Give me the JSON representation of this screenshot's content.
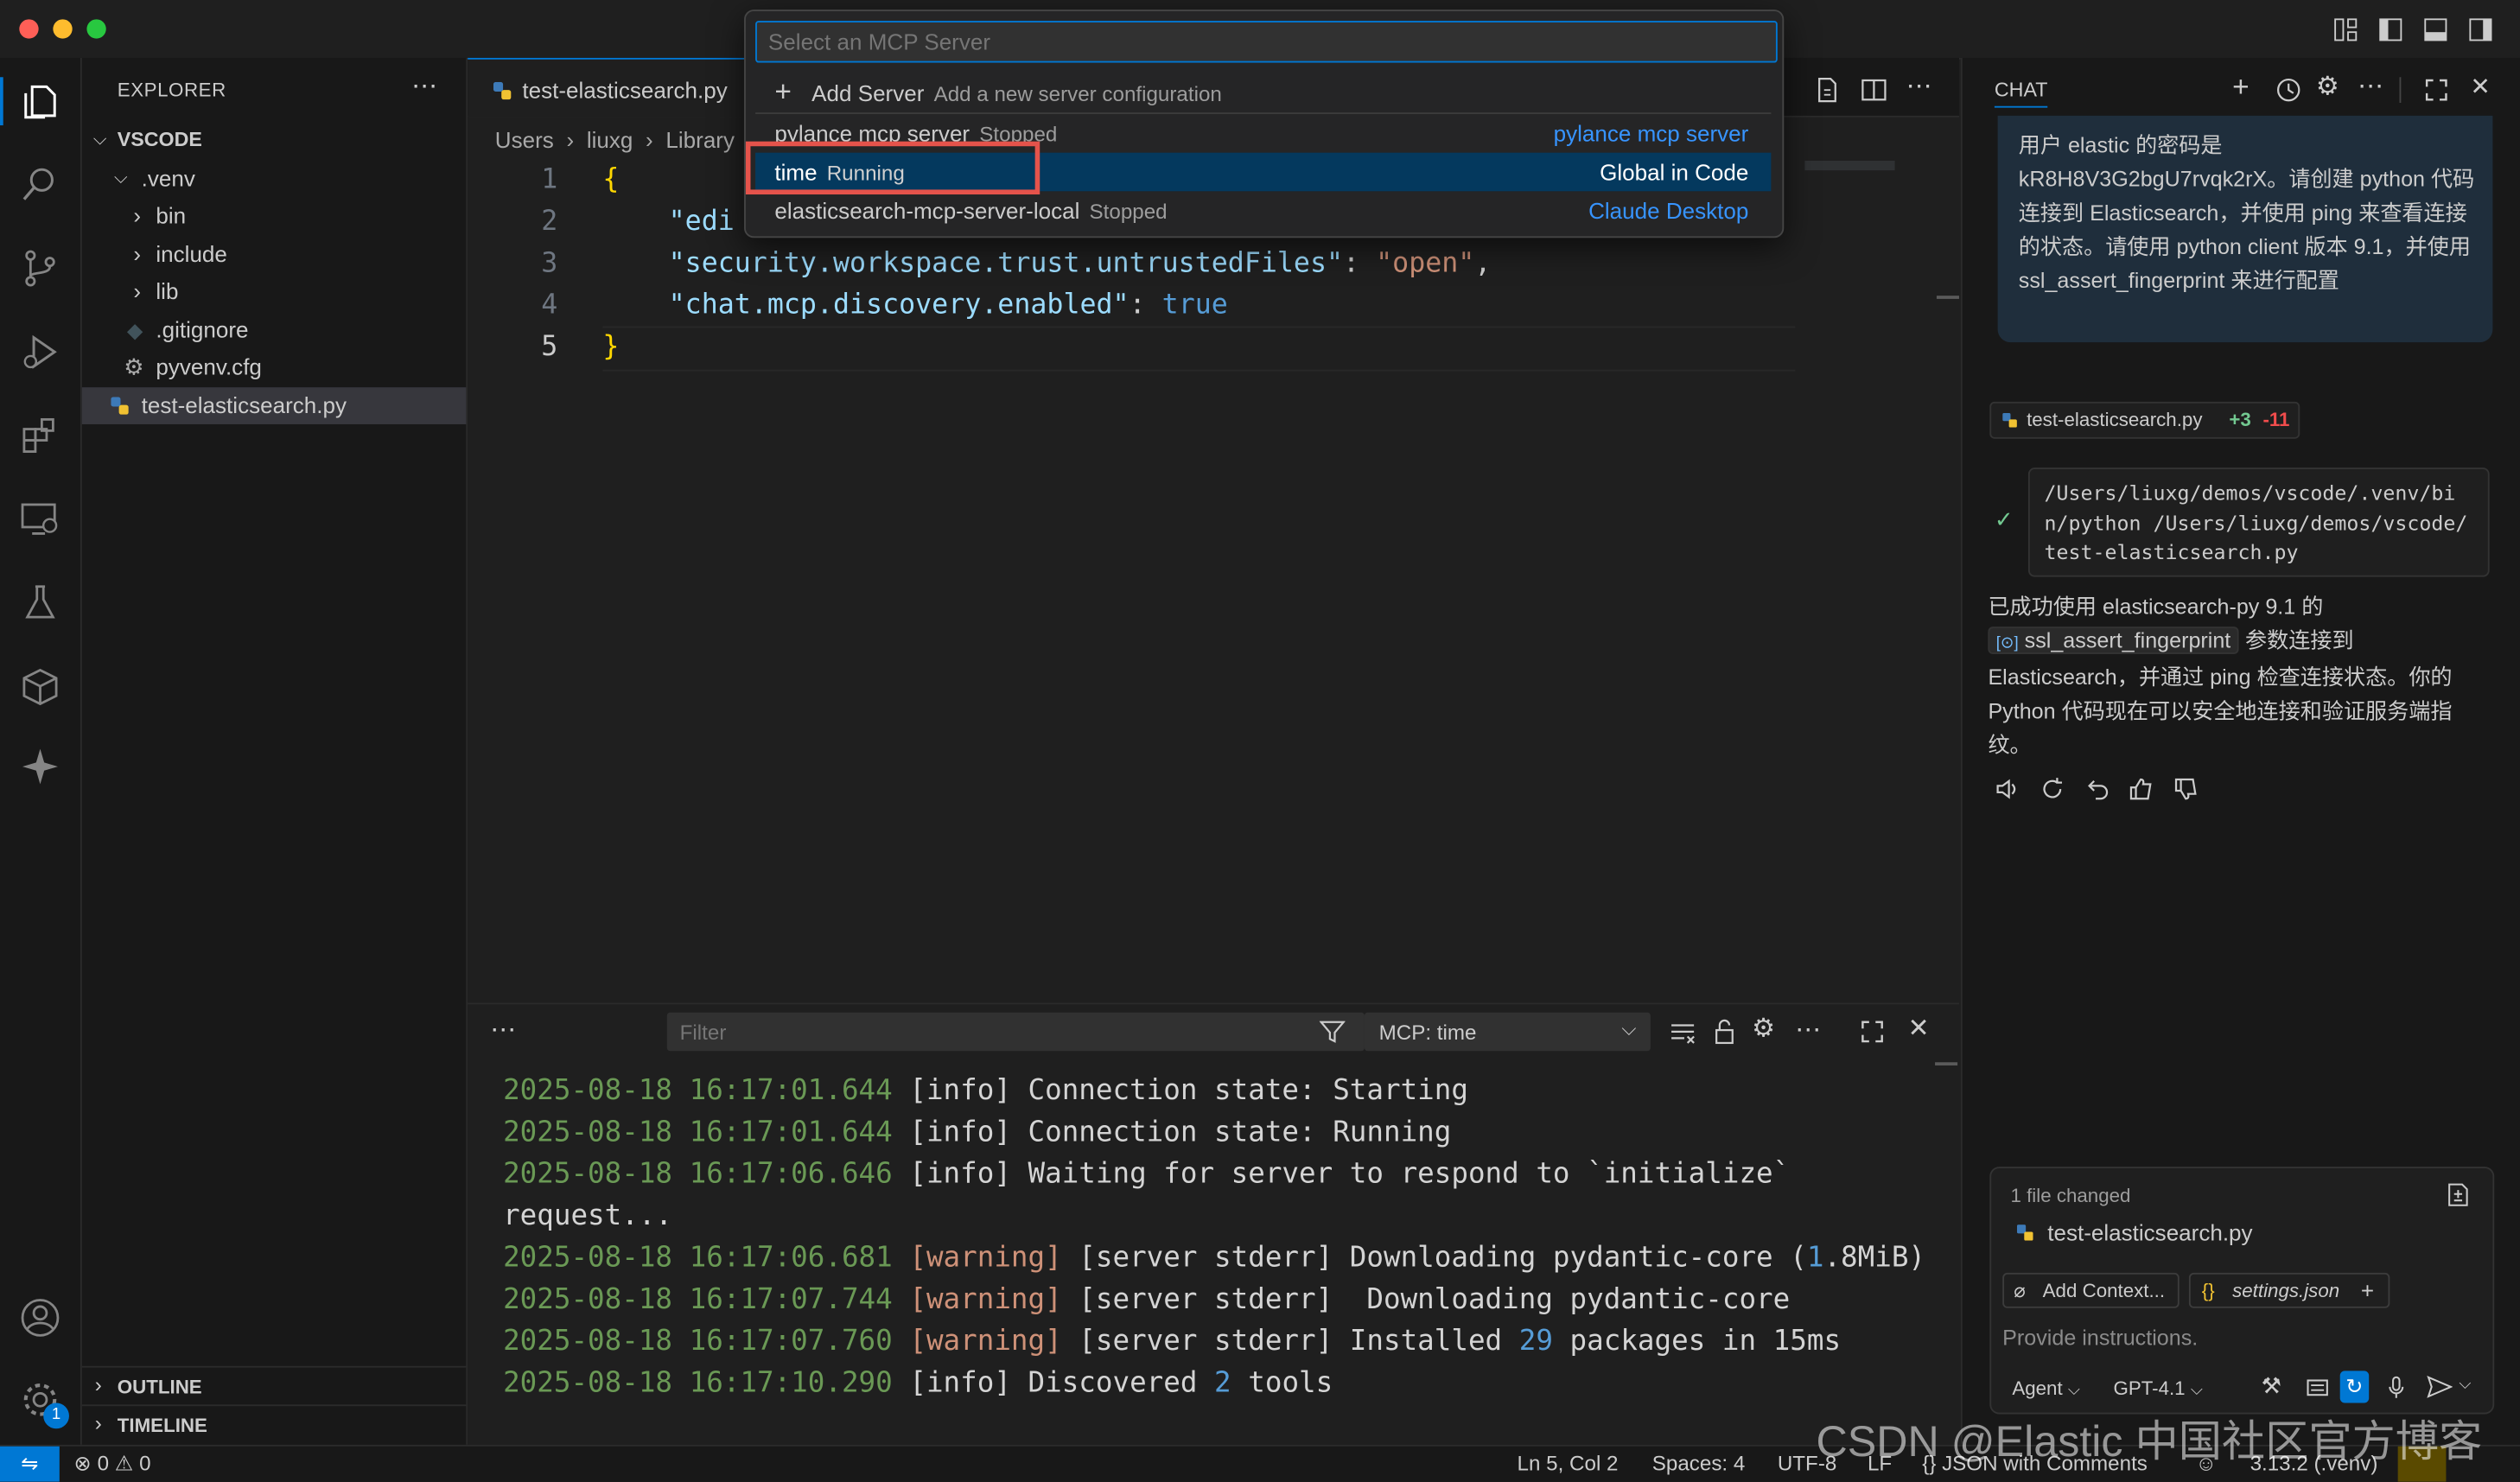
{
  "quick_pick": {
    "placeholder": "Select an MCP Server",
    "add_server": {
      "label": "Add Server",
      "desc": "Add a new server configuration"
    },
    "servers": [
      {
        "name": "pylance mcp server",
        "status": "Stopped",
        "source": "pylance mcp server"
      },
      {
        "name": "time",
        "status": "Running",
        "source": "Global in Code"
      },
      {
        "name": "elasticsearch-mcp-server-local",
        "status": "Stopped",
        "source": "Claude Desktop"
      }
    ]
  },
  "sidebar": {
    "title": "EXPLORER",
    "folder": "VSCODE",
    "items": [
      {
        "label": ".venv"
      },
      {
        "label": "bin"
      },
      {
        "label": "include"
      },
      {
        "label": "lib"
      },
      {
        "label": ".gitignore"
      },
      {
        "label": "pyvenv.cfg"
      },
      {
        "label": "test-elasticsearch.py"
      }
    ],
    "outline": "OUTLINE",
    "timeline": "TIMELINE"
  },
  "editor": {
    "tab": "test-elasticsearch.py",
    "breadcrumb": [
      "Users",
      "liuxg",
      "Library"
    ],
    "line_numbers": [
      "1",
      "2",
      "3",
      "4",
      "5"
    ],
    "lines": {
      "l1": "{",
      "l2_key": "\"edi",
      "l3_key": "\"security.workspace.trust.untrustedFiles\"",
      "l3_val": "\"open\"",
      "l4_key": "\"chat.mcp.discovery.enabled\"",
      "l4_val": "true",
      "l5": "}"
    }
  },
  "panel": {
    "filter_placeholder": "Filter",
    "channel": "MCP: time",
    "logs": [
      {
        "ts": "2025-08-18 16:17:01.644",
        "level": "[info]",
        "pre": " Connection state: Starting",
        "num": "",
        "post": ""
      },
      {
        "ts": "2025-08-18 16:17:01.644",
        "level": "[info]",
        "pre": " Connection state: Running",
        "num": "",
        "post": ""
      },
      {
        "ts": "2025-08-18 16:17:06.646",
        "level": "[info]",
        "pre": " Waiting for server to respond to `initialize`",
        "num": "",
        "post": ""
      },
      {
        "ts": "",
        "level": "",
        "pre": "request...",
        "num": "",
        "post": ""
      },
      {
        "ts": "2025-08-18 16:17:06.681",
        "level": "[warning]",
        "pre": " [server stderr] Downloading pydantic-core (",
        "num": "1",
        "post": ".8MiB)"
      },
      {
        "ts": "2025-08-18 16:17:07.744",
        "level": "[warning]",
        "pre": " [server stderr]  Downloading pydantic-core",
        "num": "",
        "post": ""
      },
      {
        "ts": "2025-08-18 16:17:07.760",
        "level": "[warning]",
        "pre": " [server stderr] Installed ",
        "num": "29",
        "post": " packages in 15ms"
      },
      {
        "ts": "2025-08-18 16:17:10.290",
        "level": "[info]",
        "pre": " Discovered ",
        "num": "2",
        "post": " tools"
      }
    ]
  },
  "chat": {
    "title": "CHAT",
    "user_message": "用户 elastic 的密码是 kR8H8V3G2bgU7rvqk2rX。请创建 python 代码连接到 Elasticsearch，并使用 ping 来查看连接的状态。请使用 python client 版本 9.1，并使用 ssl_assert_fingerprint 来进行配置",
    "file_pill": {
      "name": "test-elasticsearch.py",
      "added": "+3",
      "removed": "-11"
    },
    "terminal_cmd": "/Users/liuxg/demos/vscode/.venv/bin/python /Users/liuxg/demos/vscode/test-elasticsearch.py",
    "response_1": "已成功使用 elasticsearch-py 9.1 的",
    "response_code": "ssl_assert_fingerprint",
    "response_2": "参数连接到",
    "response_3": "Elasticsearch，并通过 ping 检查连接状态。你的 Python 代码现在可以安全地连接和验证服务端指纹。",
    "changed_title": "1 file changed",
    "changed_file": "test-elasticsearch.py",
    "add_context": "Add Context...",
    "settings_chip": "settings.json",
    "input_placeholder": "Provide instructions.",
    "mode": "Agent",
    "model": "GPT-4.1"
  },
  "status": {
    "errors": "0",
    "warnings": "0",
    "position": "Ln 5, Col 2",
    "spaces": "Spaces: 4",
    "encoding": "UTF-8",
    "eol": "LF",
    "language": "JSON with Comments",
    "interpreter": "3.13.2 (.venv)"
  },
  "watermark": "CSDN @Elastic 中国社区官方博客"
}
